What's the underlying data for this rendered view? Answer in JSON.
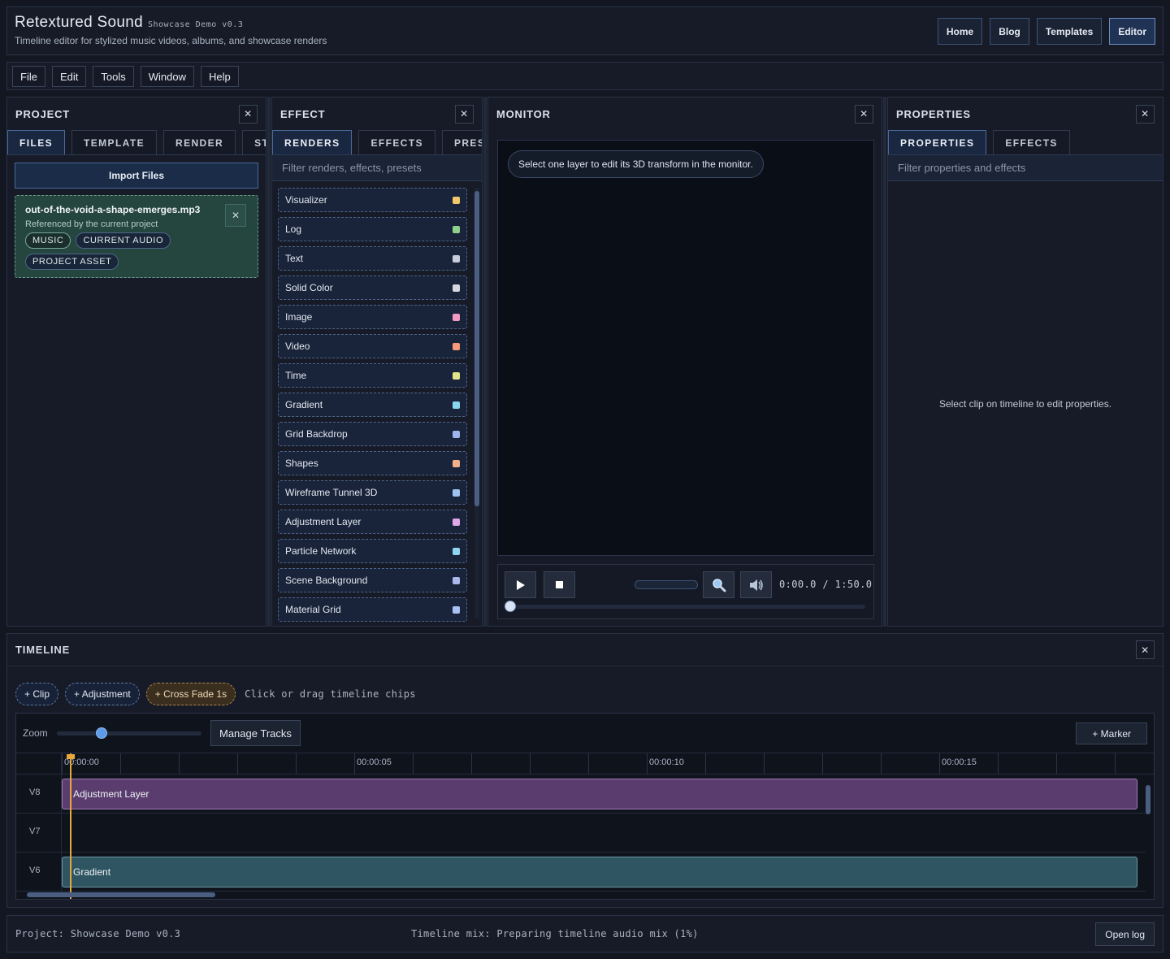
{
  "header": {
    "title": "Retextured Sound",
    "version": "Showcase Demo v0.3",
    "subtitle": "Timeline editor for stylized music videos, albums, and showcase renders",
    "nav": [
      "Home",
      "Blog",
      "Templates",
      "Editor"
    ],
    "active_nav": "Editor"
  },
  "menu": [
    "File",
    "Edit",
    "Tools",
    "Window",
    "Help"
  ],
  "project": {
    "title": "PROJECT",
    "tabs": [
      "FILES",
      "TEMPLATE",
      "RENDER",
      "ST"
    ],
    "import_label": "Import Files",
    "file": {
      "name": "out-of-the-void-a-shape-emerges.mp3",
      "note": "Referenced by the current project",
      "tags": [
        "MUSIC",
        "CURRENT AUDIO",
        "PROJECT ASSET"
      ]
    }
  },
  "effect": {
    "title": "EFFECT",
    "tabs": [
      "RENDERS",
      "EFFECTS",
      "PRES"
    ],
    "filter_placeholder": "Filter renders, effects, presets",
    "items": [
      {
        "label": "Visualizer",
        "color": "#f2c66b"
      },
      {
        "label": "Log",
        "color": "#8fd18a"
      },
      {
        "label": "Text",
        "color": "#c7cedb"
      },
      {
        "label": "Solid Color",
        "color": "#d4d8e0"
      },
      {
        "label": "Image",
        "color": "#f29ac2"
      },
      {
        "label": "Video",
        "color": "#f59a7a"
      },
      {
        "label": "Time",
        "color": "#e3e38a"
      },
      {
        "label": "Gradient",
        "color": "#8ad6ee"
      },
      {
        "label": "Grid Backdrop",
        "color": "#9db4ee"
      },
      {
        "label": "Shapes",
        "color": "#f2b08a"
      },
      {
        "label": "Wireframe Tunnel 3D",
        "color": "#9fc4f2"
      },
      {
        "label": "Adjustment Layer",
        "color": "#e0a7e8"
      },
      {
        "label": "Particle Network",
        "color": "#8fd4f0"
      },
      {
        "label": "Scene Background",
        "color": "#a9b9ee"
      },
      {
        "label": "Material Grid",
        "color": "#a9c1f2"
      }
    ]
  },
  "monitor": {
    "title": "MONITOR",
    "hint": "Select one layer to edit its 3D transform in the monitor.",
    "time": "0:00.0 / 1:50.0",
    "progress": 0
  },
  "properties": {
    "title": "PROPERTIES",
    "tabs": [
      "PROPERTIES",
      "EFFECTS"
    ],
    "filter_placeholder": "Filter properties and effects",
    "empty": "Select clip on timeline to edit properties."
  },
  "timeline": {
    "title": "TIMELINE",
    "chips": [
      "+ Clip",
      "+ Adjustment",
      "+ Cross Fade 1s"
    ],
    "hint": "Click or drag timeline chips",
    "zoom_label": "Zoom",
    "manage_label": "Manage Tracks",
    "marker_label": "+ Marker",
    "ruler": [
      "00:00:00",
      "00:00:05",
      "00:00:10",
      "00:00:15"
    ],
    "tracks": [
      {
        "name": "V8",
        "clip": "Adjustment Layer"
      },
      {
        "name": "V7",
        "clip": ""
      },
      {
        "name": "V6",
        "clip": "Gradient"
      }
    ]
  },
  "status": {
    "project": "Project: Showcase Demo v0.3",
    "mix": "Timeline mix: Preparing timeline audio mix (1%)",
    "log_label": "Open log"
  }
}
